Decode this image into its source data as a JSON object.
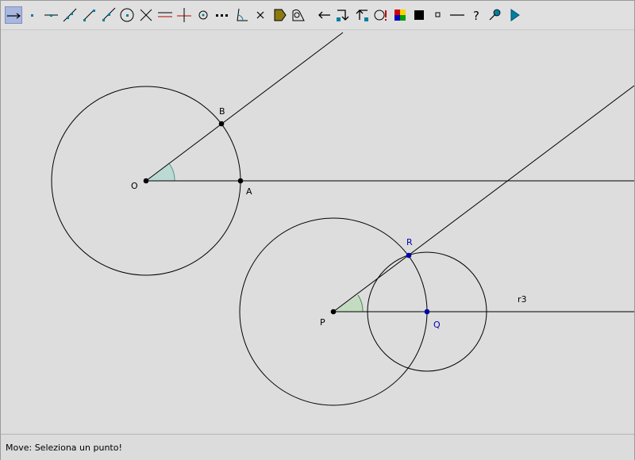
{
  "toolbar": {
    "tools": [
      "move-tool",
      "point-tool",
      "point-on-object-tool",
      "line-tool",
      "segment-tool",
      "ray-tool",
      "circle-tool",
      "intersection-tool",
      "parallel-tool",
      "perpendicular-tool",
      "midpoint-tool",
      "dashed-line-tool",
      "angle-tool",
      "delete-tool",
      "fill-tool",
      "measure-tool",
      "undo-tool",
      "redo-tool",
      "macro-tool",
      "animation-tool",
      "color-palette-tool",
      "fill-black-tool",
      "point-style-tool",
      "line-style-tool",
      "help-tool",
      "hide-show-tool",
      "play-tool"
    ],
    "active": "move-tool",
    "accent": "#a9b6dd"
  },
  "canvas": {
    "labels": {
      "O": "O",
      "A": "A",
      "B": "B",
      "P": "P",
      "Q": "Q",
      "R": "R",
      "r3": "r3"
    },
    "colors": {
      "stroke": "#000000",
      "point_black": "#000000",
      "point_blue": "#0000aa",
      "angle_fill": "#bcd9d4",
      "angle_fill_2": "#c3dcc1"
    }
  },
  "status": {
    "text": "Move: Seleziona un punto!"
  }
}
